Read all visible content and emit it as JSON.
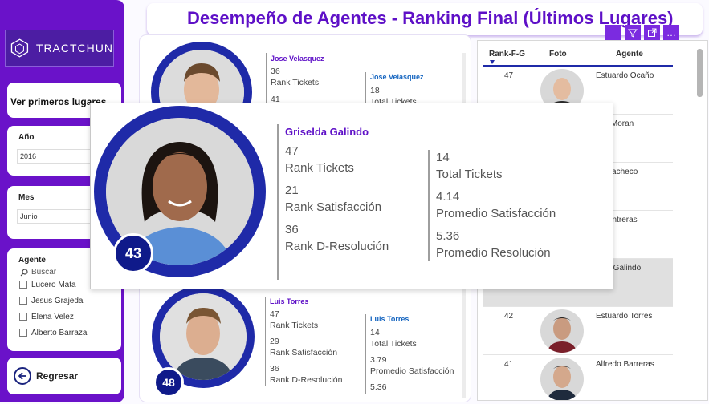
{
  "sidebar": {
    "logo_text": "TRACTCHUN",
    "first_places_button": "Ver primeros lugares",
    "year": {
      "label": "Año",
      "value": "2016"
    },
    "month": {
      "label": "Mes",
      "value": "Junio"
    },
    "agent": {
      "label": "Agente",
      "search_placeholder": "Buscar",
      "options": [
        "Lucero Mata",
        "Jesus Grajeda",
        "Elena Velez",
        "Alberto Barraza"
      ]
    },
    "back_button": "Regresar"
  },
  "header": {
    "title": "Desempeño de Agentes - Ranking Final (Últimos Lugares)",
    "icons": [
      "pin-icon",
      "filter-icon",
      "expand-icon",
      "more-options-icon"
    ]
  },
  "cards": [
    {
      "name": "Jose Velasquez",
      "rank_tickets": "36",
      "rank_tickets_label": "Rank Tickets",
      "rank_satisfaction": "41",
      "total_tickets": "18",
      "total_tickets_label": "Total Tickets"
    },
    {
      "name": "Luis Torres",
      "rank_badge": "48",
      "rank_tickets": "47",
      "rank_tickets_label": "Rank Tickets",
      "rank_satisfaction": "29",
      "rank_satisfaction_label": "Rank Satisfacción",
      "rank_resolution": "36",
      "rank_resolution_label": "Rank D-Resolución",
      "total_tickets": "14",
      "total_tickets_label": "Total Tickets",
      "avg_satisfaction": "3.79",
      "avg_satisfaction_label": "Promedio Satisfacción",
      "avg_resolution": "5.36"
    }
  ],
  "tooltip": {
    "name": "Griselda Galindo",
    "rank_badge": "43",
    "rank_tickets": "47",
    "rank_tickets_label": "Rank Tickets",
    "rank_satisfaction": "21",
    "rank_satisfaction_label": "Rank Satisfacción",
    "rank_resolution": "36",
    "rank_resolution_label": "Rank D-Resolución",
    "total_tickets": "14",
    "total_tickets_label": "Total Tickets",
    "avg_satisfaction": "4.14",
    "avg_satisfaction_label": "Promedio Satisfacción",
    "avg_resolution": "5.36",
    "avg_resolution_label": "Promedio Resolución"
  },
  "table": {
    "columns": [
      "Rank-F-G",
      "Foto",
      "Agente"
    ],
    "rows": [
      {
        "rank": "47",
        "agent": "Estuardo Ocaño"
      },
      {
        "rank": "",
        "agent": "pez Moran"
      },
      {
        "rank": "",
        "agent": "us Pacheco"
      },
      {
        "rank": "",
        "agent": "s Contreras"
      },
      {
        "rank": "",
        "agent": "elda Galindo"
      },
      {
        "rank": "42",
        "agent": "Estuardo Torres"
      },
      {
        "rank": "41",
        "agent": "Alfredo Barreras"
      }
    ]
  },
  "colors": {
    "brand": "#6a12c9",
    "ring": "#1f2aa8",
    "title": "#5e10c7"
  }
}
